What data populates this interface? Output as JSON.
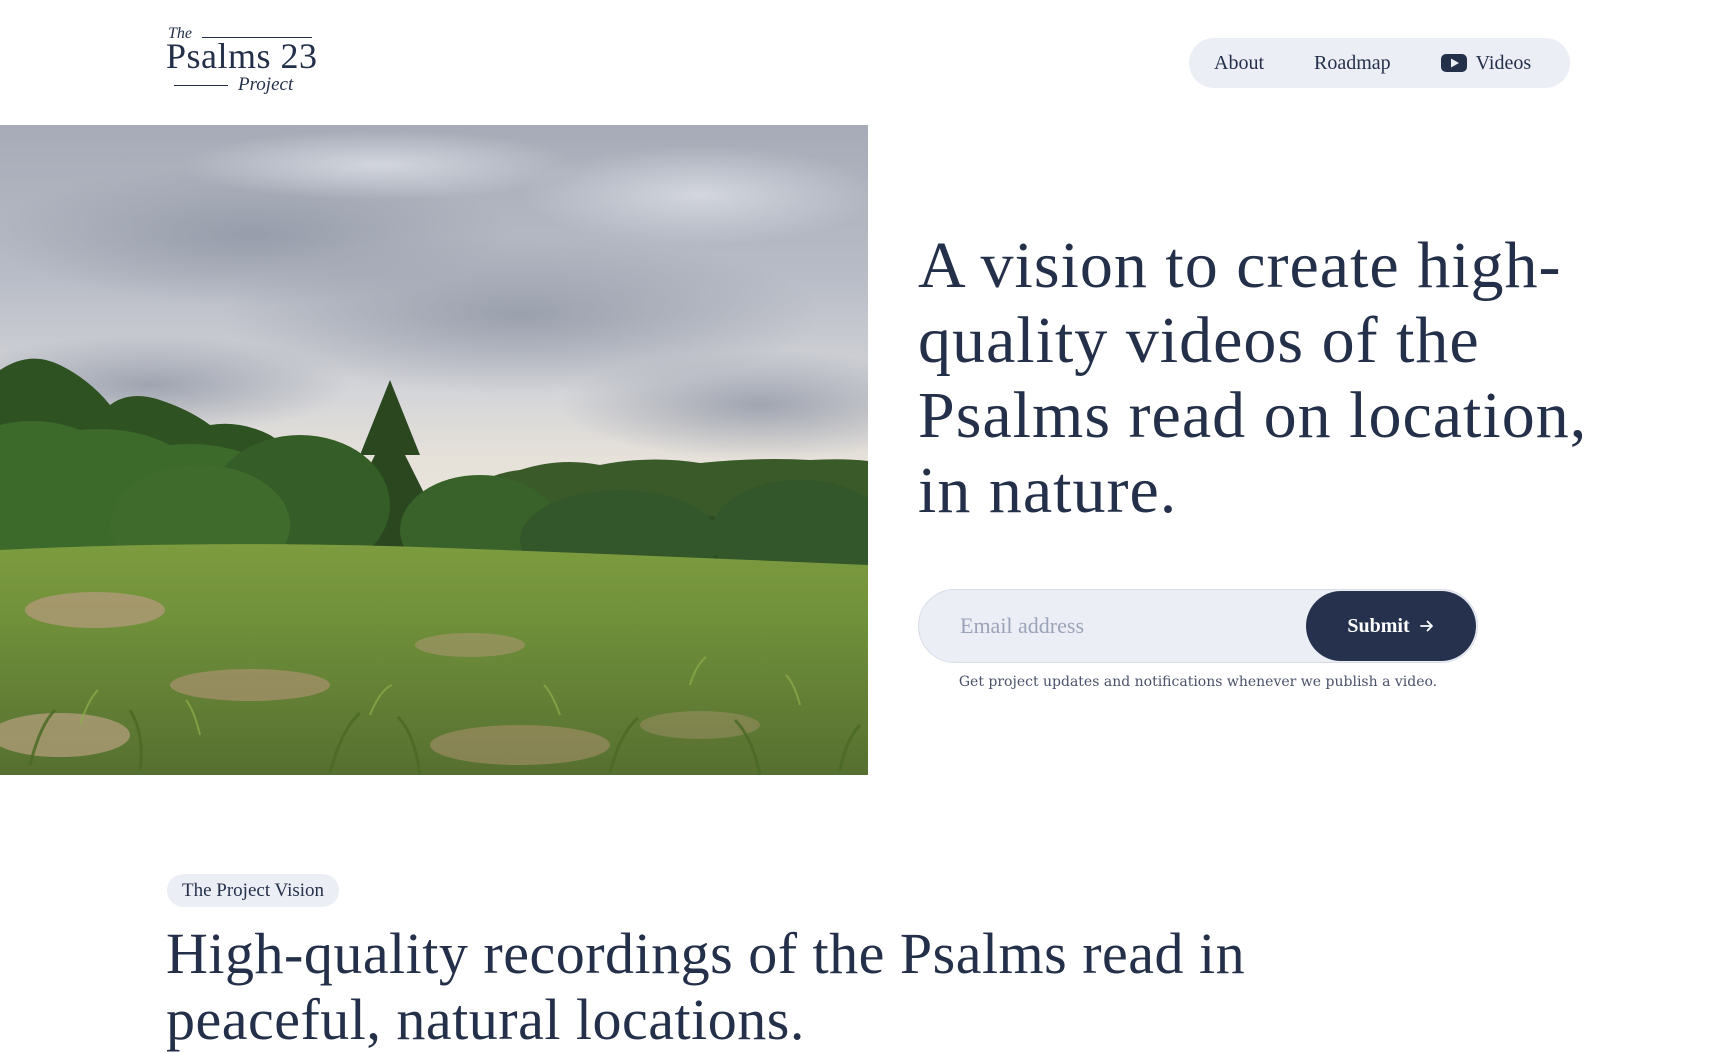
{
  "logo": {
    "the": "The",
    "main": "Psalms 23",
    "project": "Project"
  },
  "nav": {
    "items": [
      {
        "label": "About"
      },
      {
        "label": "Roadmap"
      },
      {
        "label": "Videos",
        "icon": "youtube-icon"
      }
    ]
  },
  "hero": {
    "image": "meadow-under-cloudy-sky",
    "title": "A vision to create high-quality videos of the Psalms read on location, in nature.",
    "signup": {
      "placeholder": "Email address",
      "value": "",
      "submit_label": "Submit",
      "submit_icon": "arrow-right-icon",
      "note": "Get project updates and notifications whenever we publish a video."
    }
  },
  "vision": {
    "badge": "The Project Vision",
    "title": "High-quality recordings of the Psalms read in peaceful, natural locations."
  },
  "colors": {
    "primary": "#243049",
    "pill_background": "#eceef6",
    "button": "#26324d",
    "muted_text": "#4a5269"
  }
}
